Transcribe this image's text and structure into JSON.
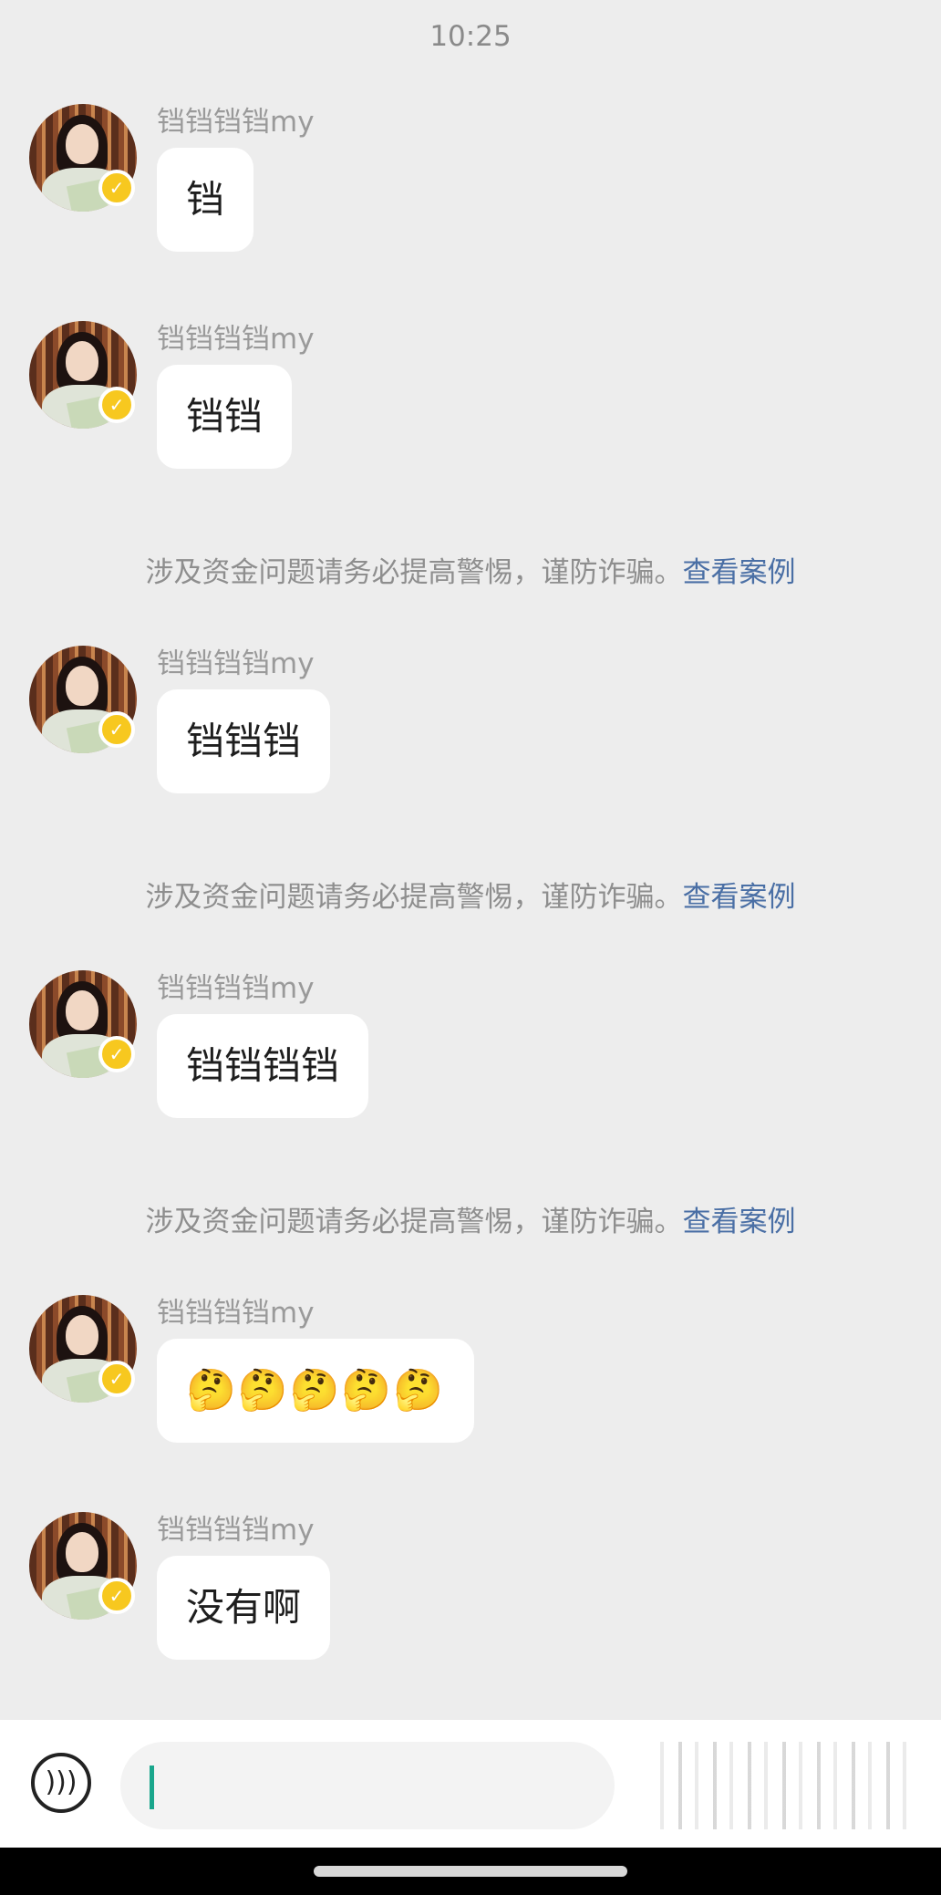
{
  "status": {
    "time": "10:25"
  },
  "messages": [
    {
      "sender": "铛铛铛铛my",
      "text": "铛"
    },
    {
      "sender": "铛铛铛铛my",
      "text": "铛铛"
    },
    {
      "sender": "铛铛铛铛my",
      "text": "铛铛铛"
    },
    {
      "sender": "铛铛铛铛my",
      "text": "铛铛铛铛"
    },
    {
      "sender": "铛铛铛铛my",
      "text": "🤔🤔🤔🤔🤔"
    },
    {
      "sender": "铛铛铛铛my",
      "text": "没有啊"
    }
  ],
  "notices": [
    {
      "text": "涉及资金问题请务必提高警惕，谨防诈骗。",
      "link": "查看案例"
    },
    {
      "text": "涉及资金问题请务必提高警惕，谨防诈骗。",
      "link": "查看案例"
    },
    {
      "text": "涉及资金问题请务必提高警惕，谨防诈骗。",
      "link": "查看案例"
    }
  ],
  "badge": {
    "symbol": "✓",
    "color": "#f7c81f"
  },
  "input": {
    "voice_icon": "voice-icon",
    "placeholder": ""
  },
  "colors": {
    "background": "#ededed",
    "bubble": "#ffffff",
    "link": "#4a6fa5",
    "caret": "#1aa68c"
  }
}
